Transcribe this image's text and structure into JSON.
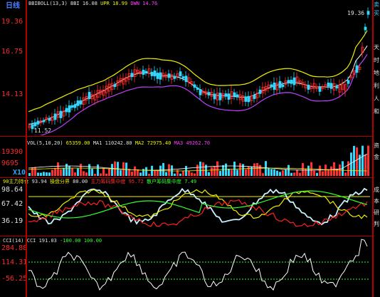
{
  "price_panel": {
    "period_label": "日线",
    "indicator_header": [
      {
        "text": "BBIBOLL(13,3) BBI 16.08",
        "color": "#e0e0e0"
      },
      {
        "text": "UPR 18.99",
        "color": "#f0f000"
      },
      {
        "text": "DWN 14.76",
        "color": "#ff40ff"
      }
    ],
    "y_ticks": [
      "19.36",
      "16.75",
      "14.13"
    ],
    "high_label": "19.36",
    "low_label": "11.52",
    "colors": {
      "up": "#ff3030",
      "down": "#30d8ff",
      "bbi": "#ffffff",
      "upr": "#f0f000",
      "dwn": "#c040ff"
    }
  },
  "volume_panel": {
    "header": [
      {
        "text": "VOL(5,10,20)",
        "color": "#e0e0e0"
      },
      {
        "text": "65359.00",
        "color": "#f0f000"
      },
      {
        "text": "MA1 110242.80",
        "color": "#e0e0e0"
      },
      {
        "text": "MA2 72975.40",
        "color": "#f0f000"
      },
      {
        "text": "MA3 49262.70",
        "color": "#ff40ff"
      }
    ],
    "y_ticks": [
      "19390",
      "9695"
    ],
    "unit": "X10"
  },
  "chip_panel": {
    "header": [
      {
        "text": "90主力持仓",
        "color": "#f0f000"
      },
      {
        "text": "93.94",
        "color": "#e0e0e0"
      },
      {
        "text": "操盘分界",
        "color": "#f0f000"
      },
      {
        "text": "80.00",
        "color": "#e0e0e0"
      },
      {
        "text": "主力筹码集中度",
        "color": "#ff3030"
      },
      {
        "text": "95.72",
        "color": "#ff3030"
      },
      {
        "text": "散户筹码集中度",
        "color": "#30ff30"
      },
      {
        "text": "7.49",
        "color": "#30ff30"
      }
    ],
    "y_ticks": [
      "98.64",
      "67.42",
      "36.19"
    ]
  },
  "cci_panel": {
    "header": [
      {
        "text": "CCI(14)",
        "color": "#e0e0e0"
      },
      {
        "text": "CCI 191.03",
        "color": "#e0e0e0"
      },
      {
        "text": "-100.00",
        "color": "#30ff30"
      },
      {
        "text": "100.00",
        "color": "#30ff30"
      }
    ],
    "y_ticks": [
      "284.88",
      "114.31",
      "-56.25"
    ]
  },
  "side_text": [
    "卖",
    "买",
    "天",
    "时",
    "地",
    "利",
    "人",
    "和",
    "资",
    "金",
    "成",
    "本",
    "研",
    "判"
  ]
}
